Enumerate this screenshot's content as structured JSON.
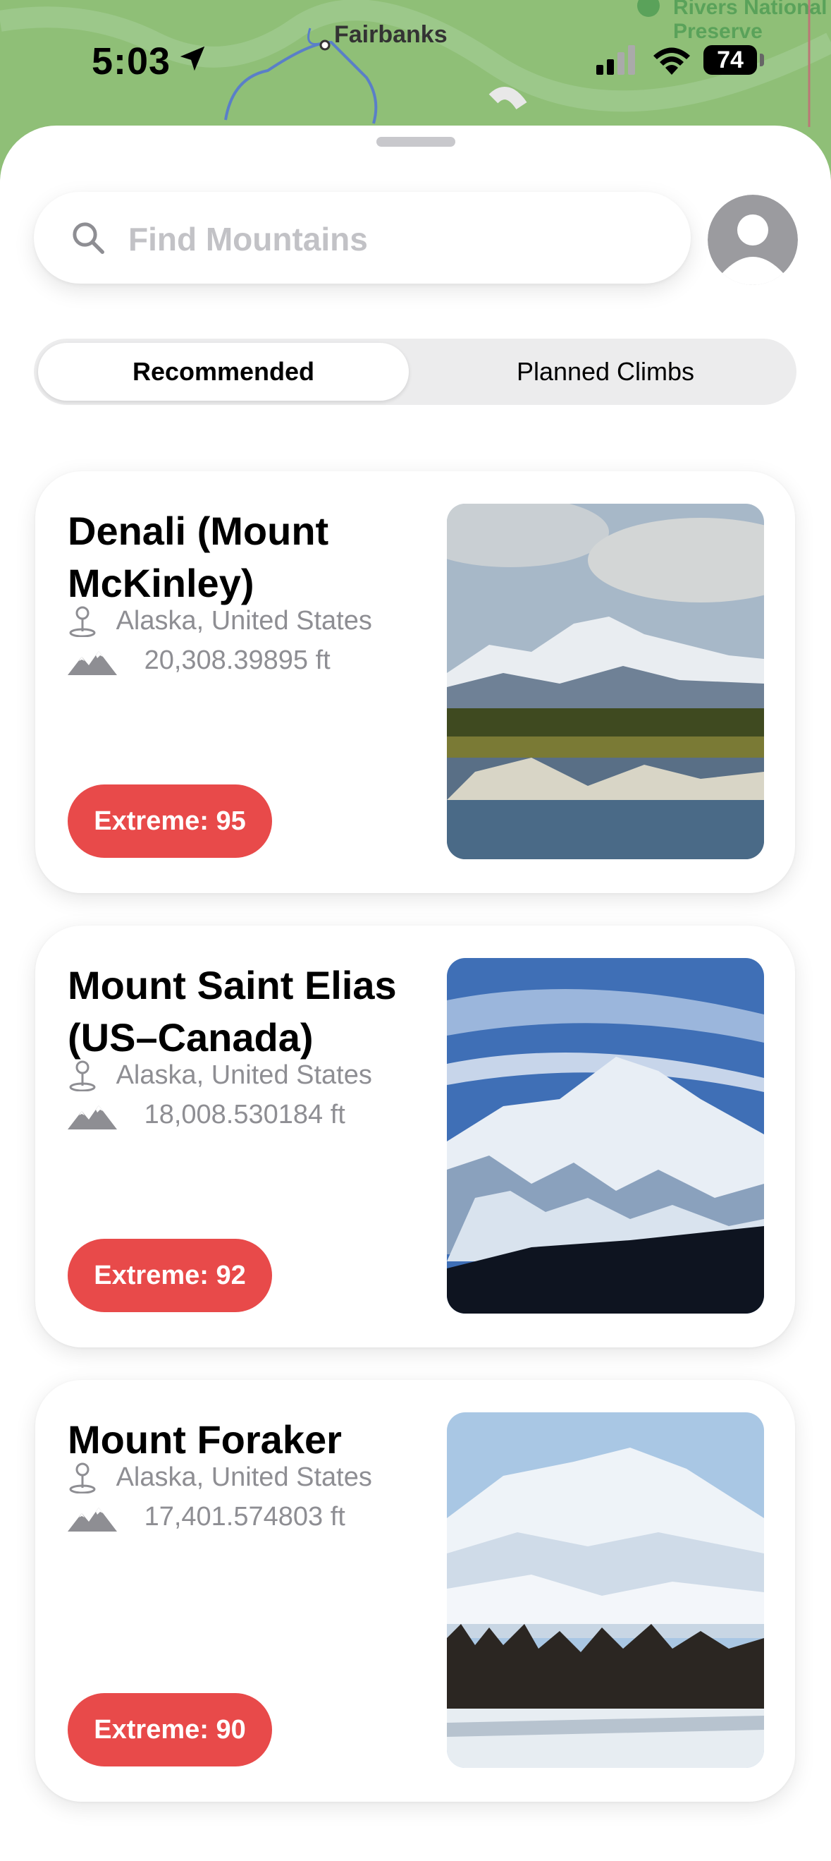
{
  "status_bar": {
    "time": "5:03",
    "battery": "74"
  },
  "map": {
    "labels": [
      "Fairbanks",
      "Rivers National",
      "Preserve"
    ]
  },
  "search": {
    "placeholder": "Find Mountains"
  },
  "segments": [
    "Recommended",
    "Planned Climbs"
  ],
  "selected_segment": "Recommended",
  "icons": [
    "location-arrow-icon",
    "signal-icon",
    "wifi-icon",
    "battery-icon",
    "search-icon",
    "profile-icon",
    "pin-icon",
    "mountains-icon"
  ],
  "colors": {
    "badge": "#e84a4a",
    "map": "#8fbf77",
    "water": "#2f7fc4"
  },
  "mountains": [
    {
      "name": "Denali (Mount McKinley)",
      "location": "Alaska, United States",
      "elevation": "20,308.39895 ft",
      "difficulty": "Extreme: 95"
    },
    {
      "name": "Mount Saint Elias (US–Canada)",
      "location": "Alaska, United States",
      "elevation": "18,008.530184 ft",
      "difficulty": "Extreme: 92"
    },
    {
      "name": "Mount Foraker",
      "location": "Alaska, United States",
      "elevation": "17,401.574803 ft",
      "difficulty": "Extreme: 90"
    }
  ]
}
